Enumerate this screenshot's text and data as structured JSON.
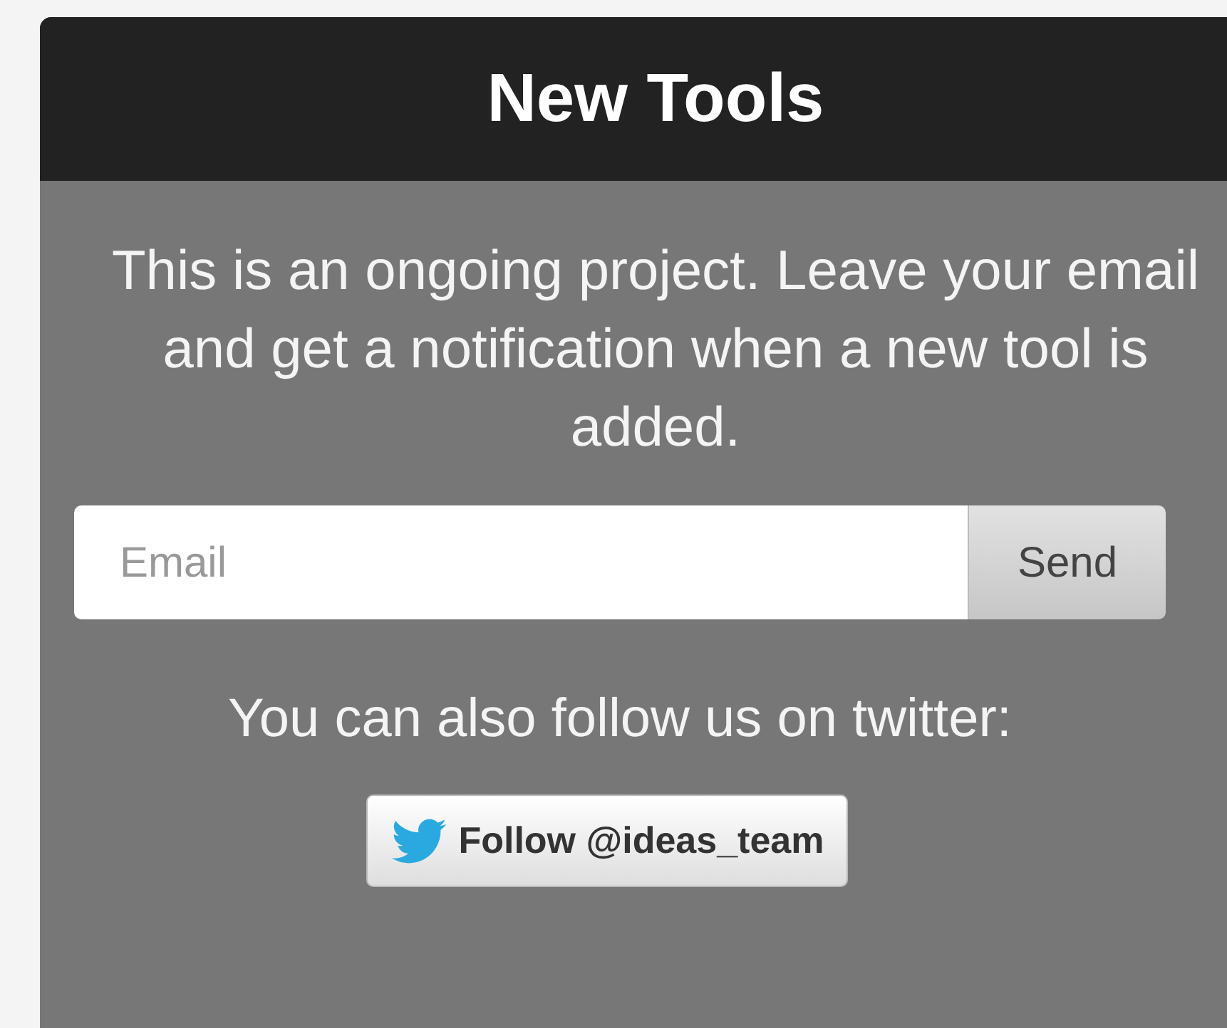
{
  "panel": {
    "title": "New Tools",
    "intro": "This is an ongoing project. Leave your email and get a notification when a new tool is added.",
    "email_field": {
      "placeholder": "Email"
    },
    "send_button": "Send",
    "twitter_note": "You can also follow us on twitter:",
    "follow_button": "Follow @ideas_team"
  }
}
